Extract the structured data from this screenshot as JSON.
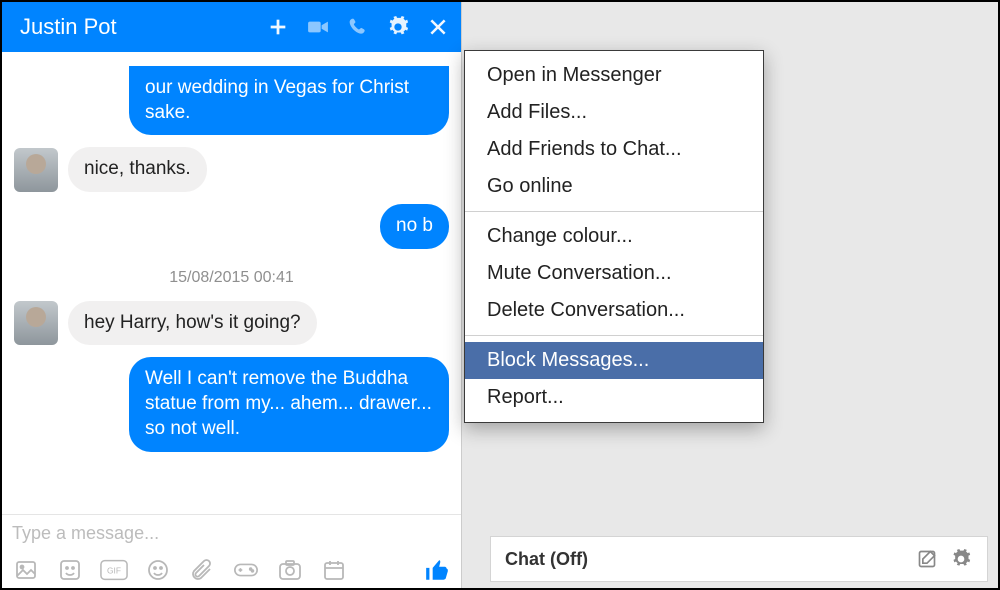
{
  "header": {
    "contact_name": "Justin Pot"
  },
  "messages": {
    "m0": "our wedding in Vegas for Christ sake.",
    "m1": "nice, thanks.",
    "m2": "no b",
    "timestamp": "15/08/2015 00:41",
    "m3": "hey Harry, how's it going?",
    "m4": "Well I can't remove the Buddha statue from my... ahem... drawer... so not well."
  },
  "composer": {
    "placeholder": "Type a message..."
  },
  "menu": {
    "open_messenger": "Open in Messenger",
    "add_files": "Add Files...",
    "add_friends": "Add Friends to Chat...",
    "go_online": "Go online",
    "change_colour": "Change colour...",
    "mute": "Mute Conversation...",
    "delete": "Delete Conversation...",
    "block": "Block Messages...",
    "report": "Report..."
  },
  "sidebar": {
    "chat_off": "Chat (Off)"
  }
}
